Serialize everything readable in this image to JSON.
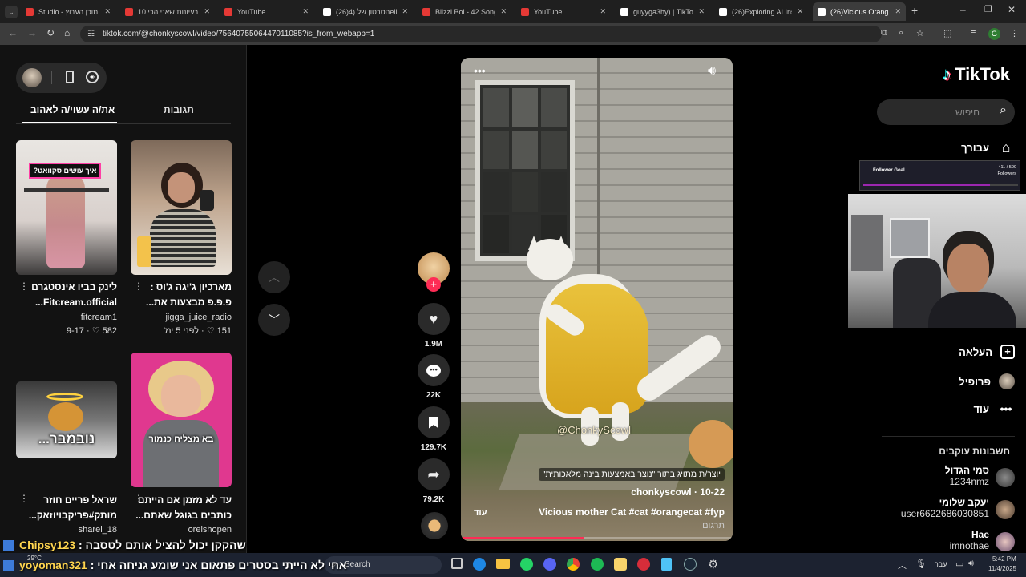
{
  "browser": {
    "tabs": [
      {
        "title": "Studio - תוכן הערוץ",
        "icon": "youtube-icon",
        "color": "#e53935"
      },
      {
        "title": "10 רעיונות שאני הכי",
        "icon": "youtube-icon",
        "color": "#e53935"
      },
      {
        "title": "YouTube",
        "icon": "youtube-icon",
        "color": "#e53935"
      },
      {
        "title": "(26)הסרטון של (4ella",
        "icon": "tiktok-icon",
        "color": "#ffffff"
      },
      {
        "title": "Blizzi Boi - 42 Song (",
        "icon": "youtube-icon",
        "color": "#e53935"
      },
      {
        "title": "YouTube",
        "icon": "youtube-icon",
        "color": "#e53935"
      },
      {
        "title": "guyyga3hy) | TikTok",
        "icon": "tiktok-icon",
        "color": "#ffffff"
      },
      {
        "title": "(26)Exploring AI Insig",
        "icon": "tiktok-icon",
        "color": "#ffffff"
      },
      {
        "title": "(26)Vicious Orang",
        "icon": "tiktok-icon",
        "color": "#ffffff"
      }
    ],
    "url": "tiktok.com/@chonkyscowl/video/7564075506447011085?is_from_webapp=1",
    "profile_letter": "G"
  },
  "left": {
    "tab_active": "את/ה עשוי/ה לאהוב",
    "tab_other": "תגובות",
    "cards": [
      {
        "overlay": "איך עושים סקוואט?",
        "title": "לינק בביו אינסטגרם Fitcream.official...",
        "user": "fitcream1",
        "meta": "582 ♡ · 9-17"
      },
      {
        "overlay": "",
        "title": "מארכיון ג'יגה ג'וס : פ.פ.פ מבצעות את...",
        "user": "jigga_juice_radio",
        "meta": "151 ♡ · לפני 5 ימ'"
      },
      {
        "overlay": "נובמבר...",
        "title": "שראל פריים חוזר מותק#פריקבויוזאק...",
        "user": "sharel_18",
        "meta": ""
      },
      {
        "overlay": "בא מצליח כנמור",
        "title": "עד לא מזמן אם הייתם כותבים בגוגל שאתם...",
        "user": "orelshopen",
        "meta": ""
      }
    ]
  },
  "video": {
    "watermark": "@ChonkyScowl",
    "ai_label": "יוצר/ת מתויג בתור \"נוצר באמצעות בינה מלאכותית\"",
    "author": "chonkyscowl · 10-22",
    "caption": "Vicious mother Cat #cat #orangecat #fyp",
    "more": "עוד",
    "translate": "תרגום"
  },
  "actions": {
    "likes": "1.9M",
    "comments": "22K",
    "saves": "129.7K",
    "shares": "79.2K"
  },
  "right": {
    "brand": "TikTok",
    "search_placeholder": "חיפוש",
    "nav": [
      {
        "label": "עבורך",
        "icon": "home-icon"
      },
      {
        "label": "העלאה",
        "icon": "upload-icon"
      },
      {
        "label": "פרופיל",
        "icon": "profile-icon"
      },
      {
        "label": "עוד",
        "icon": "more-icon"
      }
    ],
    "following_header": "חשבונות עוקבים",
    "following": [
      {
        "name": "סמי הגדול",
        "handle": "1234nmz"
      },
      {
        "name": "יעקב שלומי",
        "handle": "user6622686030851"
      },
      {
        "name": "Hae",
        "handle": "imnothae"
      }
    ],
    "overlay_goal": {
      "title": "Follower Goal",
      "count": "411 / 500",
      "unit": "Followers",
      "progress": 0.82
    }
  },
  "stream_chat": [
    {
      "user": "Chipsy123",
      "message": "שהקקן יכול להציל אותם לטסבה :"
    },
    {
      "user": "yoyoman321",
      "message": "אחי לא הייתי בסטרים פתאום אני שומע גניחה אחי :"
    }
  ],
  "taskbar": {
    "search": "Search",
    "weather": "29°C",
    "lang": "עבר",
    "time": "5:42 PM",
    "date": "11/4/2025"
  },
  "colors": {
    "accent": "#fe2c55",
    "progress": "#fe2c55",
    "overlay_purple": "#7b1fa2"
  }
}
